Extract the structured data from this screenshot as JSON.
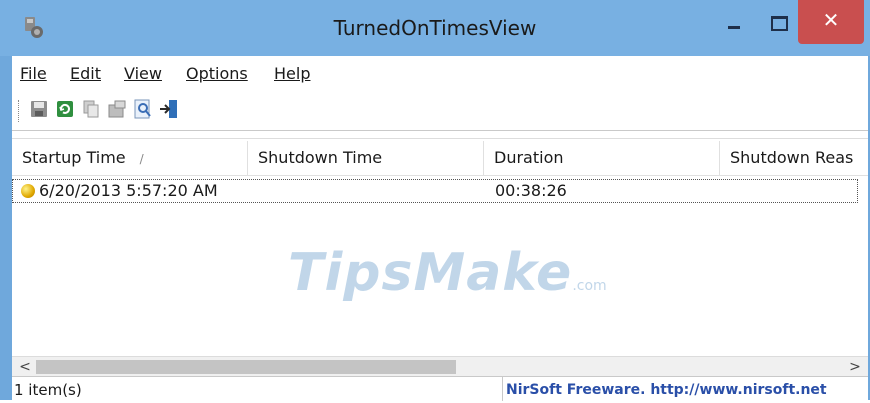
{
  "window": {
    "title": "TurnedOnTimesView",
    "close_glyph": "✕"
  },
  "menu": [
    {
      "label": "File"
    },
    {
      "label": "Edit"
    },
    {
      "label": "View"
    },
    {
      "label": "Options"
    },
    {
      "label": "Help"
    }
  ],
  "toolbar": [
    {
      "name": "save-icon"
    },
    {
      "name": "refresh-icon"
    },
    {
      "name": "copy-icon"
    },
    {
      "name": "properties-icon"
    },
    {
      "name": "find-icon"
    },
    {
      "name": "exit-icon"
    }
  ],
  "columns": [
    "Startup Time",
    "Shutdown Time",
    "Duration",
    "Shutdown Reas"
  ],
  "sort_indicator": "/",
  "rows": [
    {
      "startup": "6/20/2013 5:57:20 AM",
      "shutdown": "",
      "duration": "00:38:26",
      "reason": ""
    }
  ],
  "watermark": {
    "text": "TipsMake",
    "suffix": ".com"
  },
  "scroll": {
    "left": "<",
    "right": ">"
  },
  "status": {
    "count": "1 item(s)",
    "credit": "NirSoft Freeware.  http://www.nirsoft.net"
  },
  "colors": {
    "titlebar": "#78b0e2",
    "close_button": "#c94f4f",
    "credit_text": "#2a4fa8"
  }
}
